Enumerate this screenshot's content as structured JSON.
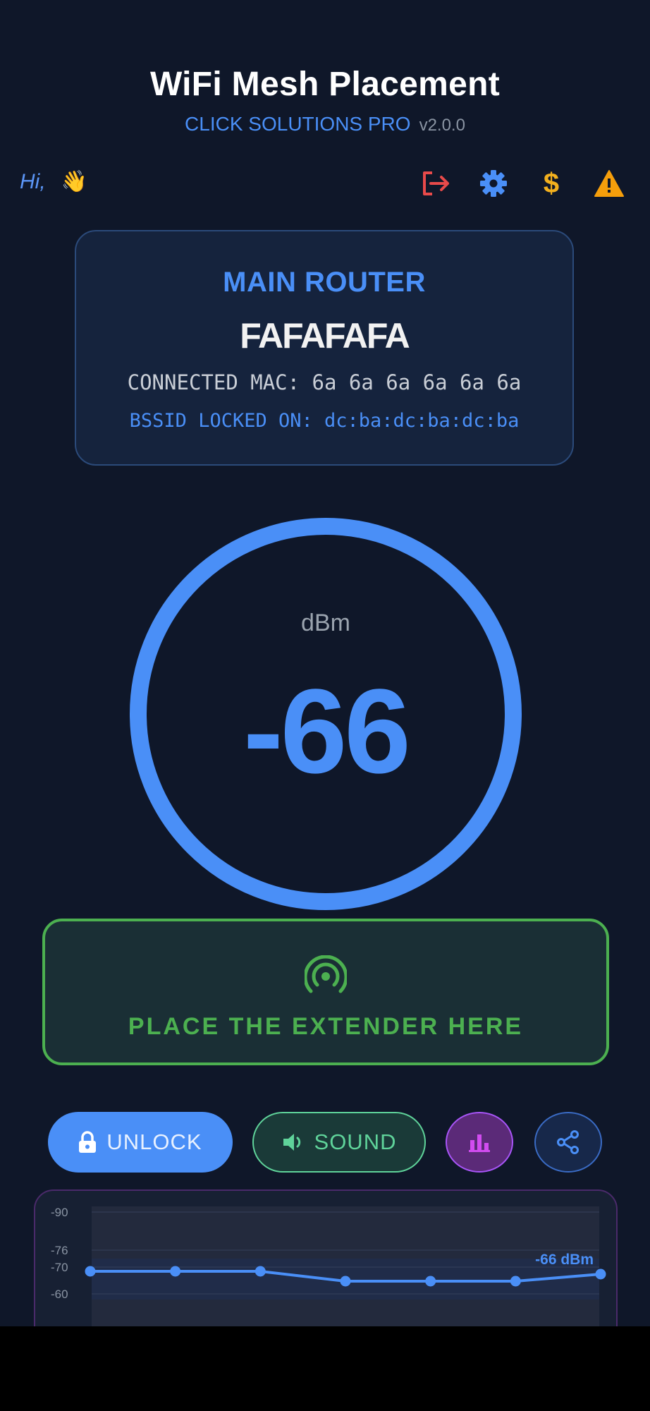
{
  "header": {
    "title": "WiFi Mesh Placement",
    "brand": "CLICK SOLUTIONS PRO",
    "version": "v2.0.0"
  },
  "greeting": {
    "text": "Hi,",
    "emoji": "👋"
  },
  "toolbar": {
    "icons": [
      "logout-icon",
      "gear-icon",
      "dollar-icon",
      "warning-icon"
    ],
    "colors": {
      "logout": "#e84a4a",
      "settings": "#4a8ff7",
      "dollar": "#f2b01e",
      "warning": "#f59e0b"
    }
  },
  "router": {
    "label": "MAIN ROUTER",
    "ssid": "FAFAFAFA",
    "mac": "CONNECTED MAC: 6a 6a 6a 6a 6a 6a",
    "bssid": "BSSID LOCKED ON: dc:ba:dc:ba:dc:ba"
  },
  "gauge": {
    "unit": "dBm",
    "value": "-66",
    "color": "#4a8ff7"
  },
  "status": {
    "icon": "signal-icon",
    "text": "PLACE THE EXTENDER HERE",
    "color": "#4cb050"
  },
  "actions": {
    "unlock_label": "UNLOCK",
    "sound_label": "SOUND",
    "chart_icon": "bar-chart-icon",
    "share_icon": "share-icon"
  },
  "chart_data": {
    "type": "line",
    "y_tick_labels": [
      "-90",
      "-76",
      "-70",
      "-60"
    ],
    "values": [
      -70,
      -70,
      -70,
      -73,
      -73,
      -73,
      -71
    ],
    "last_label": "-66 dBm",
    "color": "#4a8ff7"
  }
}
